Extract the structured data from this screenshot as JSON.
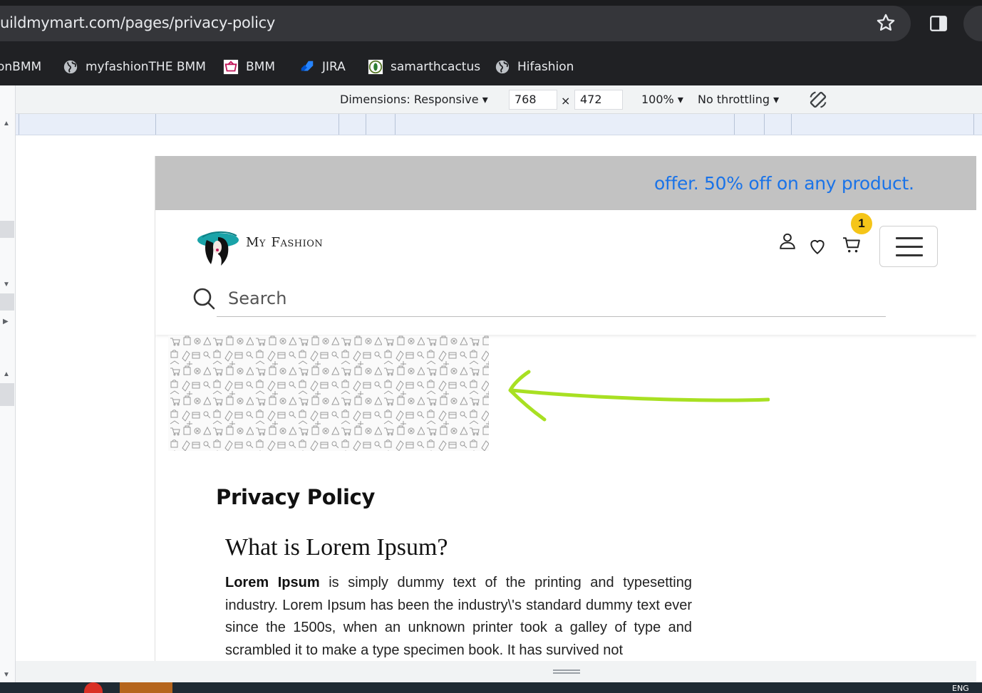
{
  "browser": {
    "url": "uildmymart.com/pages/privacy-policy",
    "bookmarks": [
      {
        "label": "onBMM",
        "icon": "none"
      },
      {
        "label": "myfashionTHE BMM",
        "icon": "globe-icon"
      },
      {
        "label": "BMM",
        "icon": "bmm-icon"
      },
      {
        "label": "JIRA",
        "icon": "jira-icon"
      },
      {
        "label": "samarthcactus",
        "icon": "cactus-icon"
      },
      {
        "label": "Hifashion",
        "icon": "globe-icon"
      }
    ]
  },
  "devtools": {
    "dimensions_label": "Dimensions: Responsive",
    "width_value": "768",
    "times": "×",
    "height_value": "472",
    "zoom_label": "100%",
    "throttling_label": "No throttling"
  },
  "page": {
    "offer_text": "offer. 50% off on any product.",
    "logo_text_my": "My",
    "logo_text_fashion": "Fashion",
    "cart_count": "1",
    "search_placeholder": "Search",
    "privacy_title": "Privacy Policy",
    "lorem_heading": "What is Lorem Ipsum?",
    "lorem_bold": "Lorem Ipsum",
    "lorem_rest": " is simply dummy text of the printing and typesetting industry. Lorem Ipsum has been the industry\\'s standard dummy text ever since the 1500s, when an unknown printer took a galley of type and scrambled it to make a type specimen book. It has survived not"
  },
  "taskbar": {
    "language": "ENG"
  },
  "colors": {
    "offer_text": "#1a73e8",
    "offer_bar": "#c2c2c2",
    "badge": "#f5c518",
    "annotation_arrow": "#a8e022"
  }
}
